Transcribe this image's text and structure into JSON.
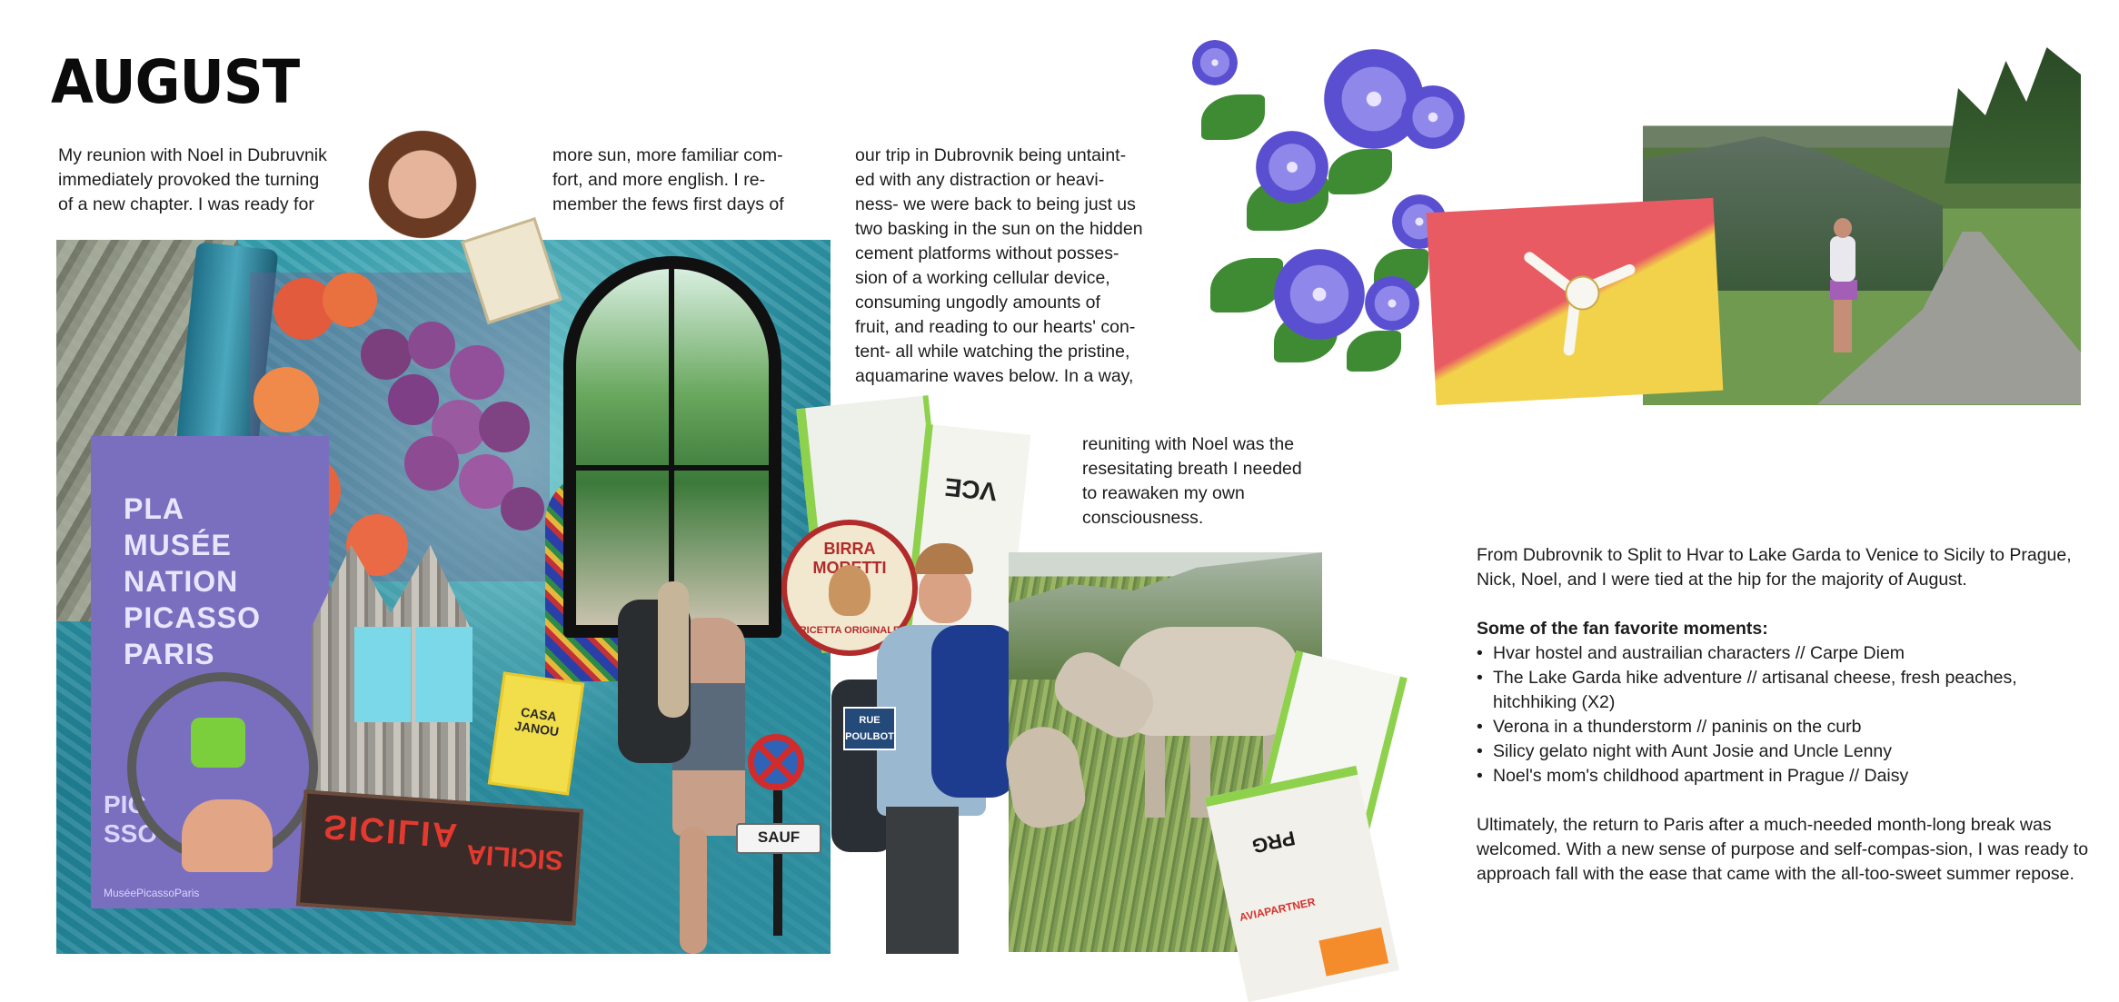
{
  "page": {
    "title": "AUGUST"
  },
  "text": {
    "col1": "My reunion with Noel in Dubruvnik\nimmediately provoked the turning\nof a new chapter. I was ready for",
    "col2": "more sun, more familiar com-\nfort, and more english. I re-\nmember the fews first days of",
    "col3": "our trip in Dubrovnik being untaint-\ned with any distraction or heavi-\nness- we were back to being just us\ntwo basking in the sun on the hidden\ncement platforms without posses-\nsion of a working cellular device,\nconsuming ungodly amounts of\nfruit, and reading to our hearts' con-\ntent- all while watching the pristine,\naquamarine waves below. In a way,",
    "col4": "reuniting with Noel was the\nresesitating breath I needed\nto reawaken my own\nconsciousness."
  },
  "sidebar": {
    "intro": "From Dubrovnik to Split to Hvar to Lake Garda to Venice to Sicily to Prague, Nick, Noel, and I were tied at the hip for the majority of August.",
    "favorites_heading": "Some of the fan favorite moments:",
    "favorites": [
      "Hvar hostel and austrailian characters // Carpe Diem",
      "The Lake Garda hike adventure // artisanal cheese, fresh peaches, hitchhiking (X2)",
      "Verona in a thunderstorm // paninis on the curb",
      "Silicy gelato night with Aunt Josie and Uncle Lenny",
      "Noel's mom's childhood apartment in Prague // Daisy"
    ],
    "closing": "Ultimately, the return to Paris after a much-needed month-long break was welcomed. With a new sense of purpose and self-compas-sion, I was ready to approach fall with the ease that came with the all-too-sweet summer repose."
  },
  "collage_text": {
    "poster_top": "PLA\nMUSÉE\nNATION\nPICASSO\nPARIS",
    "poster_bottom": "PIC\nSSO",
    "poster_footer": "MuséePicassoParis",
    "cooler_label": "SICILIA",
    "cooler_label2": "SICILIA",
    "yellow_card": "CASA\nJANOU",
    "moretti_top": "BIRRA MORETTI",
    "moretti_bottom": "RICETTA ORIGINALE",
    "ticket_code": "VCE",
    "street_sign": "RUE\nPOULBOT",
    "sauf_sign": "SAUF",
    "ticket_prg": "PRG",
    "avia_label": "AVIAPARTNER"
  },
  "colors": {
    "water": "#2a8fa3",
    "poster": "#7a6fbf",
    "flag_red": "#e95b63",
    "flag_yellow": "#f2d24a",
    "ticket_green": "#8ed14c"
  }
}
